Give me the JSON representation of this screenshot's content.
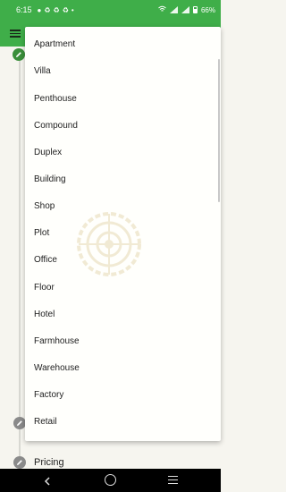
{
  "status_bar": {
    "time": "6:15",
    "left_icons": [
      "chat-icon",
      "recycle-icon",
      "recycle-icon",
      "recycle-icon",
      "dot-icon"
    ],
    "battery": "66%"
  },
  "app_bar": {
    "menu_icon": "hamburger-icon"
  },
  "background": {
    "pricing_label": "Pricing"
  },
  "dropdown": {
    "options": [
      "Apartment",
      "Villa",
      "Penthouse",
      "Compound",
      "Duplex",
      "Building",
      "Shop",
      "Plot",
      "Office",
      "Floor",
      "Hotel",
      "Farmhouse",
      "Warehouse",
      "Factory",
      "Retail"
    ]
  },
  "colors": {
    "brand_green": "#3fae49",
    "edit_green": "#3a8f3a",
    "watermark": "#e6d9b5"
  },
  "nav_bar": {
    "icons": [
      "back-icon",
      "home-icon",
      "recents-icon"
    ]
  }
}
